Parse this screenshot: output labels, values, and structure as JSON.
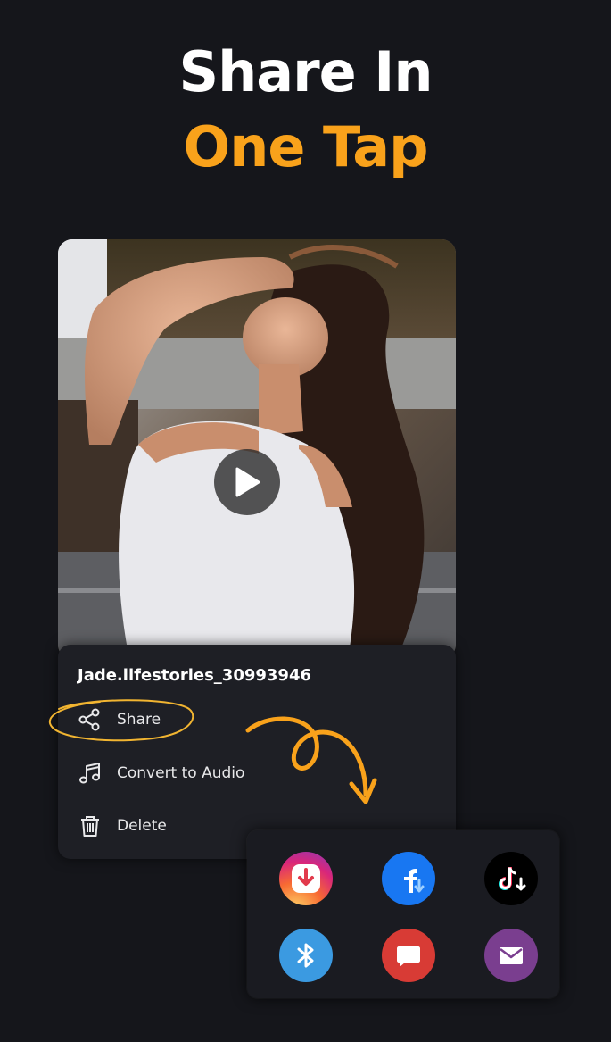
{
  "headline": {
    "line1": "Share In",
    "line2": "One Tap",
    "line2_color": "#f9a21b"
  },
  "media": {
    "filename": "Jade.lifestories_30993946"
  },
  "menu": {
    "items": [
      {
        "label": "Share",
        "icon": "share-icon"
      },
      {
        "label": "Convert to Audio",
        "icon": "music-note-icon"
      },
      {
        "label": "Delete",
        "icon": "trash-icon"
      }
    ]
  },
  "share_targets": [
    {
      "icon": "instagram-downloader-icon",
      "color": "#e1306c"
    },
    {
      "icon": "facebook-downloader-icon",
      "color": "#1877f2"
    },
    {
      "icon": "tiktok-downloader-icon",
      "color": "#000000"
    },
    {
      "icon": "bluetooth-icon",
      "color": "#3b9ae1"
    },
    {
      "icon": "message-icon",
      "color": "#d83b35"
    },
    {
      "icon": "email-icon",
      "color": "#7a3e8f"
    }
  ],
  "colors": {
    "background": "#15161b",
    "accent": "#f9a21b",
    "panel": "#1e1f25"
  }
}
